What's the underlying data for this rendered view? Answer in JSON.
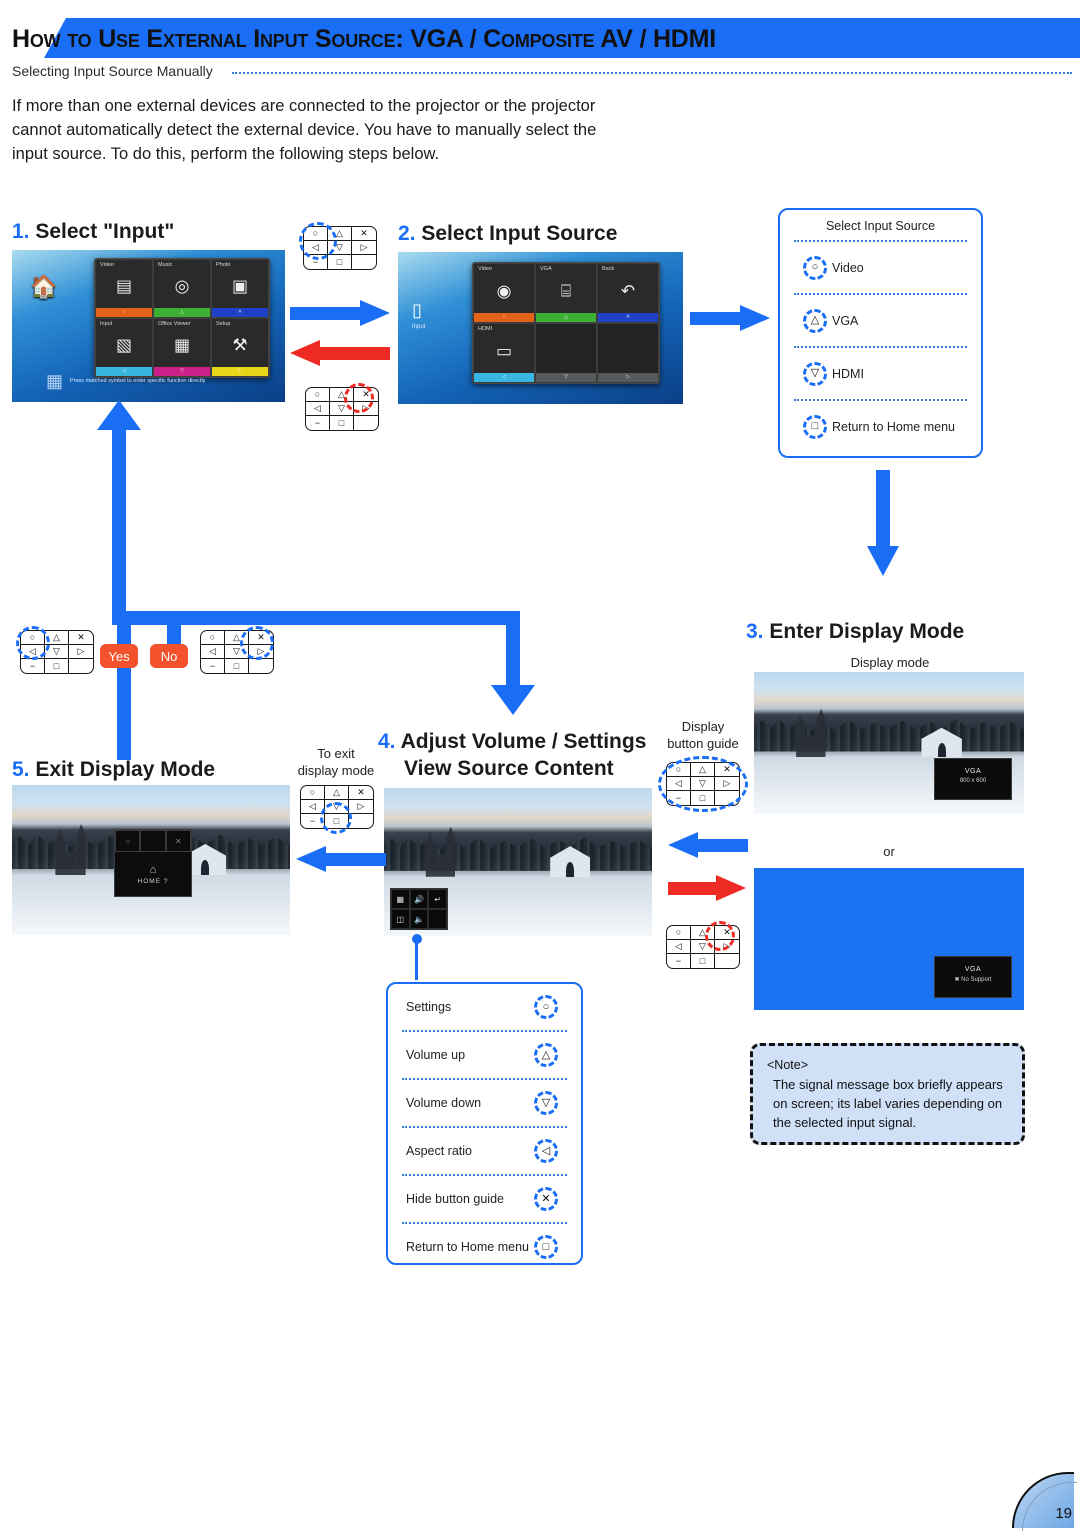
{
  "header": {
    "title": "How to Use External Input Source: VGA / Composite AV / HDMI",
    "subhead": "Selecting Input Source Manually",
    "intro": "If more than one external devices are connected to the projector or the projector cannot automatically detect the external device. You have to manually select the input source. To do this, perform the following steps below."
  },
  "steps": {
    "s1": {
      "num": "1.",
      "label": "Select \"Input\""
    },
    "s2": {
      "num": "2.",
      "label": "Select Input Source"
    },
    "s3": {
      "num": "3.",
      "label": "Enter Display Mode"
    },
    "s4": {
      "num": "4.",
      "line1": "Adjust Volume / Settings",
      "line2": "View Source Content"
    },
    "s5": {
      "num": "5.",
      "label": "Exit Display Mode"
    }
  },
  "home_screen": {
    "hint": "Press matched symbol to enter specific function directly",
    "tiles": [
      {
        "label": "Video",
        "glyph": "▤",
        "bar_color": "#e2621a",
        "bar_glyph": "○"
      },
      {
        "label": "Music",
        "glyph": "◎",
        "bar_color": "#3cb034",
        "bar_glyph": "△"
      },
      {
        "label": "Photo",
        "glyph": "▣",
        "bar_color": "#1f41c8",
        "bar_glyph": "✕"
      },
      {
        "label": "Input",
        "glyph": "▧",
        "bar_color": "#39b6e0",
        "bar_glyph": "◁"
      },
      {
        "label": "Office Viewer",
        "glyph": "▦",
        "bar_color": "#cc2089",
        "bar_glyph": "▽"
      },
      {
        "label": "Setup",
        "glyph": "⚒",
        "bar_color": "#e8d718",
        "bar_glyph": "▷"
      }
    ]
  },
  "input_screen": {
    "side_label": "Input",
    "tiles": [
      {
        "label": "Video",
        "glyph": "◉",
        "bar_color": "#e2621a",
        "bar_glyph": "○"
      },
      {
        "label": "VGA",
        "glyph": "⌸",
        "bar_color": "#3cb034",
        "bar_glyph": "△"
      },
      {
        "label": "Back",
        "glyph": "↶",
        "bar_color": "#1f41c8",
        "bar_glyph": "✕"
      },
      {
        "label": "HDMI",
        "glyph": "▭",
        "bar_color": "#39b6e0",
        "bar_glyph": "◁"
      },
      {
        "label": "",
        "glyph": "",
        "bar_color": "#555a5c",
        "bar_glyph": "▽"
      },
      {
        "label": "",
        "glyph": "",
        "bar_color": "#555a5c",
        "bar_glyph": "▷"
      }
    ]
  },
  "select_input_panel": {
    "title": "Select Input Source",
    "rows": [
      {
        "icon": "○",
        "label": "Video"
      },
      {
        "icon": "△",
        "label": "VGA"
      },
      {
        "icon": "▽",
        "label": "HDMI"
      },
      {
        "icon": "□",
        "label": "Return to Home menu"
      }
    ]
  },
  "settings_panel": {
    "rows": [
      {
        "label": "Settings",
        "icon": "○"
      },
      {
        "label": "Volume up",
        "icon": "△"
      },
      {
        "label": "Volume down",
        "icon": "▽"
      },
      {
        "label": "Aspect ratio",
        "icon": "◁"
      },
      {
        "label": "Hide button guide",
        "icon": "✕"
      },
      {
        "label": "Return to Home menu",
        "icon": "□"
      }
    ]
  },
  "captions": {
    "display_mode": "Display mode",
    "or": "or",
    "display_button_guide_l1": "Display",
    "display_button_guide_l2": "button guide",
    "to_exit_l1": "To exit",
    "to_exit_l2": "display mode"
  },
  "badges": {
    "yes": "Yes",
    "no": "No"
  },
  "signal_boxes": {
    "vga": {
      "line1": "VGA",
      "line2": "800 x 600"
    },
    "no_support": {
      "line1": "VGA",
      "line2": "No Support"
    }
  },
  "home_dialog": {
    "icon": "⌂",
    "text": "HOME ?"
  },
  "note": {
    "tag": "<Note>",
    "text": "The signal message box briefly appears on screen; its label varies depending on the selected input signal."
  },
  "keypad": {
    "keys": [
      "○",
      "△",
      "✕",
      "◁",
      "▽",
      "▷",
      "−",
      "□"
    ]
  },
  "page": {
    "number": "19"
  },
  "colors": {
    "accent_blue": "#1a6ef5",
    "accent_red": "#ee2a24",
    "badge_orange": "#f4522d"
  }
}
